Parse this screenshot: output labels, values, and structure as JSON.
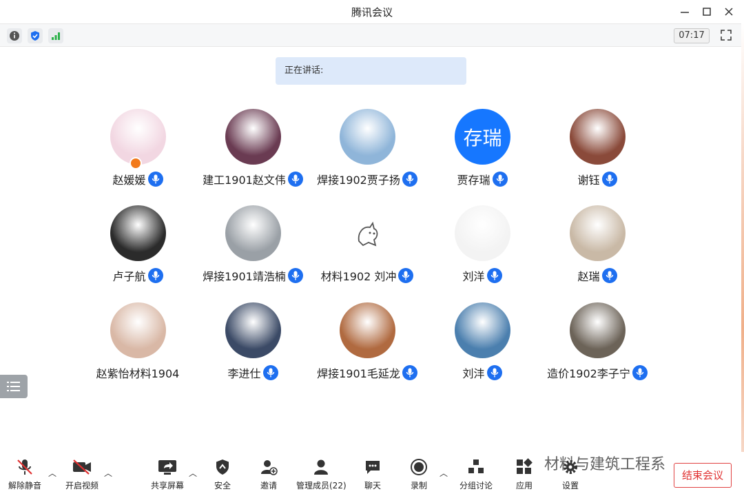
{
  "window": {
    "title": "腾讯会议"
  },
  "toolbar": {
    "timer": "07:17"
  },
  "speaking": {
    "label": "正在讲话:"
  },
  "participants": [
    {
      "name": "赵媛媛",
      "avatar_color": "#f2d7e2",
      "host": true,
      "mic": true
    },
    {
      "name": "建工1901赵文伟",
      "avatar_color": "#6a3b52",
      "mic": true
    },
    {
      "name": "焊接1902贾子扬",
      "avatar_color": "#8fb5d9",
      "mic": true
    },
    {
      "name": "贾存瑞",
      "avatar_text": "存瑞",
      "avatar_color": "#1677ff",
      "mic": true
    },
    {
      "name": "谢钰",
      "avatar_color": "#8a4a3a",
      "mic": true
    },
    {
      "name": "卢子航",
      "avatar_color": "#2b2b2b",
      "mic": true
    },
    {
      "name": "焊接1901靖浩楠",
      "avatar_color": "#9aa0a6",
      "mic": true
    },
    {
      "name": "材料1902 刘冲",
      "avatar_color": "#ffffff",
      "mic": true
    },
    {
      "name": "刘洋",
      "avatar_color": "#f3f3f3",
      "mic": true
    },
    {
      "name": "赵瑞",
      "avatar_color": "#c9b9a6",
      "mic": true
    },
    {
      "name": "赵紫怡材料1904",
      "avatar_color": "#d9b8a6",
      "mic": false
    },
    {
      "name": "李进仕",
      "avatar_color": "#3b4a66",
      "mic": true
    },
    {
      "name": "焊接1901毛延龙",
      "avatar_color": "#b06a40",
      "mic": true
    },
    {
      "name": "刘沣",
      "avatar_color": "#4b7fae",
      "mic": true
    },
    {
      "name": "造价1902李子宁",
      "avatar_color": "#6c6358",
      "mic": true
    }
  ],
  "bottombar": {
    "unmute": "解除静音",
    "start_video": "开启视频",
    "share_screen": "共享屏幕",
    "security": "安全",
    "invite": "邀请",
    "manage_members": "管理成员(22)",
    "chat": "聊天",
    "record": "录制",
    "breakout": "分组讨论",
    "apps": "应用",
    "settings": "设置",
    "end_meeting": "结束会议"
  },
  "watermark": "材料与建筑工程系",
  "colors": {
    "accent": "#1e6ff0",
    "end": "#e03030",
    "speaking_bg": "#dde9fa"
  }
}
